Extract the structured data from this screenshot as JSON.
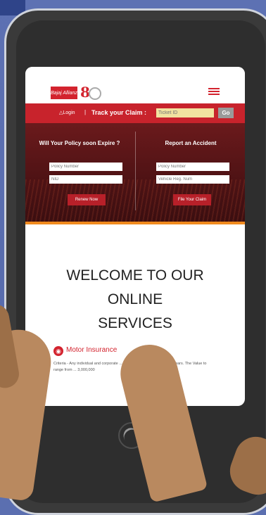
{
  "brand": {
    "logo_text": "Bajaj Allianz",
    "anniversary_number": "8",
    "accent_color": "#d3232e"
  },
  "claim_bar": {
    "login_label": "Login",
    "separator": "|",
    "track_label": "Track your Claim :",
    "ticket_placeholder": "Ticket ID",
    "go_label": "Go"
  },
  "renewal": {
    "title": "Will Your Policy soon Expire ?",
    "policy_placeholder": "Policy Number",
    "second_placeholder": "NID",
    "button_label": "Renew Now"
  },
  "accident": {
    "title": "Report an Accident",
    "policy_placeholder": "Policy Number",
    "vehicle_placeholder": "Vehicle Reg. Num",
    "button_label": "File Your Claim"
  },
  "welcome": {
    "line1": "WELCOME TO OUR",
    "line2": "ONLINE",
    "line3": "SERVICES"
  },
  "motor": {
    "icon": "car-icon",
    "title": "Motor Insurance",
    "description": "Criteria - Any individual and corporate ... Private Car aged less than 3 years. The Value to range from ... 3,000,000"
  },
  "icons": {
    "user": "user-icon",
    "menu": "hamburger-icon",
    "home": "home-button-icon"
  }
}
